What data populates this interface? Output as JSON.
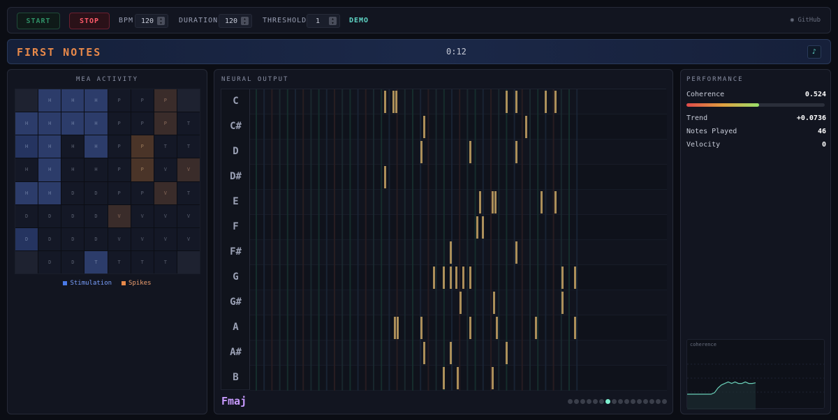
{
  "topbar": {
    "start_label": "START",
    "stop_label": "STOP",
    "bpm_label": "BPM",
    "bpm_value": "120",
    "duration_label": "DURATION",
    "duration_value": "120",
    "threshold_label": "THRESHOLD",
    "threshold_value": "1",
    "demo_label": "DEMO",
    "github_label": "GitHub"
  },
  "banner": {
    "title": "FIRST NOTES",
    "time": "0:12",
    "icon": "music-note-icon"
  },
  "mea": {
    "title": "MEA ACTIVITY",
    "grid": [
      [
        "",
        "H",
        "H",
        "H",
        "P",
        "P",
        "P",
        ""
      ],
      [
        "H",
        "H",
        "H",
        "H",
        "P",
        "P",
        "P",
        "T"
      ],
      [
        "H",
        "H",
        "H",
        "H",
        "P",
        "P",
        "T",
        "T"
      ],
      [
        "H",
        "H",
        "H",
        "H",
        "P",
        "P",
        "V",
        "V"
      ],
      [
        "H",
        "H",
        "D",
        "D",
        "P",
        "P",
        "V",
        "T"
      ],
      [
        "D",
        "D",
        "D",
        "D",
        "V",
        "V",
        "V",
        "V"
      ],
      [
        "D",
        "D",
        "D",
        "D",
        "V",
        "V",
        "V",
        "V"
      ],
      [
        "",
        "D",
        "D",
        "T",
        "T",
        "T",
        "T",
        ""
      ]
    ],
    "states": [
      [
        "empty",
        "stim",
        "stim",
        "stim",
        "n",
        "n",
        "spike",
        ""
      ],
      [
        "stim",
        "stim",
        "stim",
        "stim",
        "n",
        "n",
        "spike",
        "n"
      ],
      [
        "stim2",
        "stim",
        "n",
        "stim",
        "n",
        "spike2",
        "n",
        "n"
      ],
      [
        "n",
        "stim",
        "n",
        "n",
        "n",
        "spike2",
        "n",
        "spike"
      ],
      [
        "stim",
        "stim",
        "n",
        "n",
        "n",
        "n",
        "spike",
        "n"
      ],
      [
        "n",
        "n",
        "n",
        "n",
        "spike",
        "n",
        "n",
        "n"
      ],
      [
        "stim2",
        "n",
        "n",
        "n",
        "n",
        "n",
        "n",
        "n"
      ],
      [
        "empty",
        "n",
        "n",
        "stim",
        "n",
        "n",
        "n",
        "empty"
      ]
    ],
    "legend": [
      {
        "label": "Stimulation",
        "color": "#4a7ae8"
      },
      {
        "label": "Spikes",
        "color": "#e8894a"
      }
    ]
  },
  "neural": {
    "title": "NEURAL OUTPUT",
    "notes": [
      "C",
      "C#",
      "D",
      "D#",
      "E",
      "F",
      "F#",
      "G",
      "G#",
      "A",
      "A#",
      "B"
    ],
    "chord": "Fmaj",
    "events": [
      {
        "note": "C",
        "cols": [
          192,
          204,
          208,
          366,
          380,
          422,
          436
        ]
      },
      {
        "note": "C#",
        "cols": [
          248,
          394
        ]
      },
      {
        "note": "D",
        "cols": [
          244,
          314,
          380
        ]
      },
      {
        "note": "D#",
        "cols": [
          192
        ]
      },
      {
        "note": "E",
        "cols": [
          328,
          346,
          350,
          416,
          436
        ]
      },
      {
        "note": "F",
        "cols": [
          324,
          332
        ]
      },
      {
        "note": "F#",
        "cols": [
          286,
          380
        ]
      },
      {
        "note": "G",
        "cols": [
          262,
          276,
          286,
          294,
          304,
          314,
          446,
          464
        ]
      },
      {
        "note": "G#",
        "cols": [
          300,
          348,
          446
        ]
      },
      {
        "note": "A",
        "cols": [
          206,
          210,
          244,
          314,
          352,
          408,
          464
        ]
      },
      {
        "note": "A#",
        "cols": [
          248,
          286,
          366
        ]
      },
      {
        "note": "B",
        "cols": [
          276,
          296,
          346
        ]
      }
    ],
    "page_count": 16,
    "active_page": 6
  },
  "performance": {
    "title": "PERFORMANCE",
    "coherence_label": "Coherence",
    "coherence_value": "0.524",
    "coherence_fraction": 0.524,
    "trend_label": "Trend",
    "trend_value": "+0.0736",
    "notes_played_label": "Notes Played",
    "notes_played_value": "46",
    "velocity_label": "Velocity",
    "velocity_value": "0",
    "mini_chart_label": "coherence",
    "mini_series": [
      0.45,
      0.45,
      0.45,
      0.45,
      0.45,
      0.45,
      0.45,
      0.45,
      0.46,
      0.49,
      0.51,
      0.52,
      0.53,
      0.52,
      0.53,
      0.52,
      0.52,
      0.53,
      0.52,
      0.52,
      0.524
    ]
  }
}
